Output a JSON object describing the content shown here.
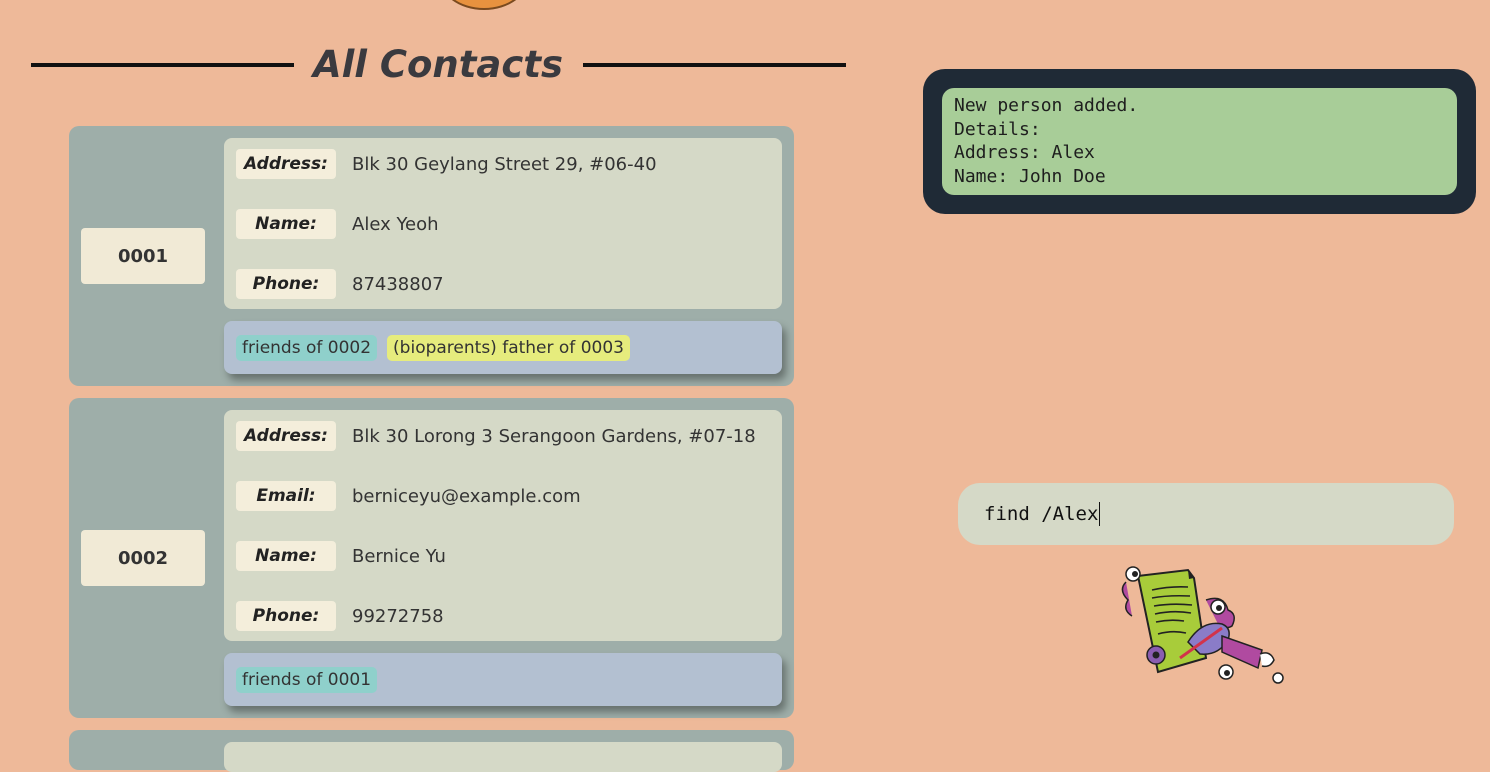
{
  "header": {
    "title": "All Contacts"
  },
  "contacts": [
    {
      "id": "0001",
      "fields": [
        {
          "label": "Address:",
          "value": "Blk 30 Geylang Street 29, #06-40"
        },
        {
          "label": "Name:",
          "value": "Alex Yeoh"
        },
        {
          "label": "Phone:",
          "value": "87438807"
        }
      ],
      "tags": [
        {
          "text": "friends of 0002",
          "color": "#8fd0cb"
        },
        {
          "text": "(bioparents) father of 0003",
          "color": "#e6ec7d"
        }
      ]
    },
    {
      "id": "0002",
      "fields": [
        {
          "label": "Address:",
          "value": "Blk 30 Lorong 3 Serangoon Gardens, #07-18"
        },
        {
          "label": "Email:",
          "value": "berniceyu@example.com"
        },
        {
          "label": "Name:",
          "value": "Bernice Yu"
        },
        {
          "label": "Phone:",
          "value": "99272758"
        }
      ],
      "tags": [
        {
          "text": "friends of 0001",
          "color": "#8fd0cb"
        }
      ]
    }
  ],
  "result": {
    "lines": [
      "New person added.",
      "Details:",
      "Address: Alex",
      "Name: John Doe"
    ]
  },
  "command": {
    "value": "find /Alex"
  },
  "colors": {
    "background": "#eeb999",
    "card": "#9eaea9",
    "result_dark": "#1f2a36",
    "result_green": "#a8cd98"
  },
  "icons": {
    "mascot": "document-with-pen-mascot-icon"
  }
}
